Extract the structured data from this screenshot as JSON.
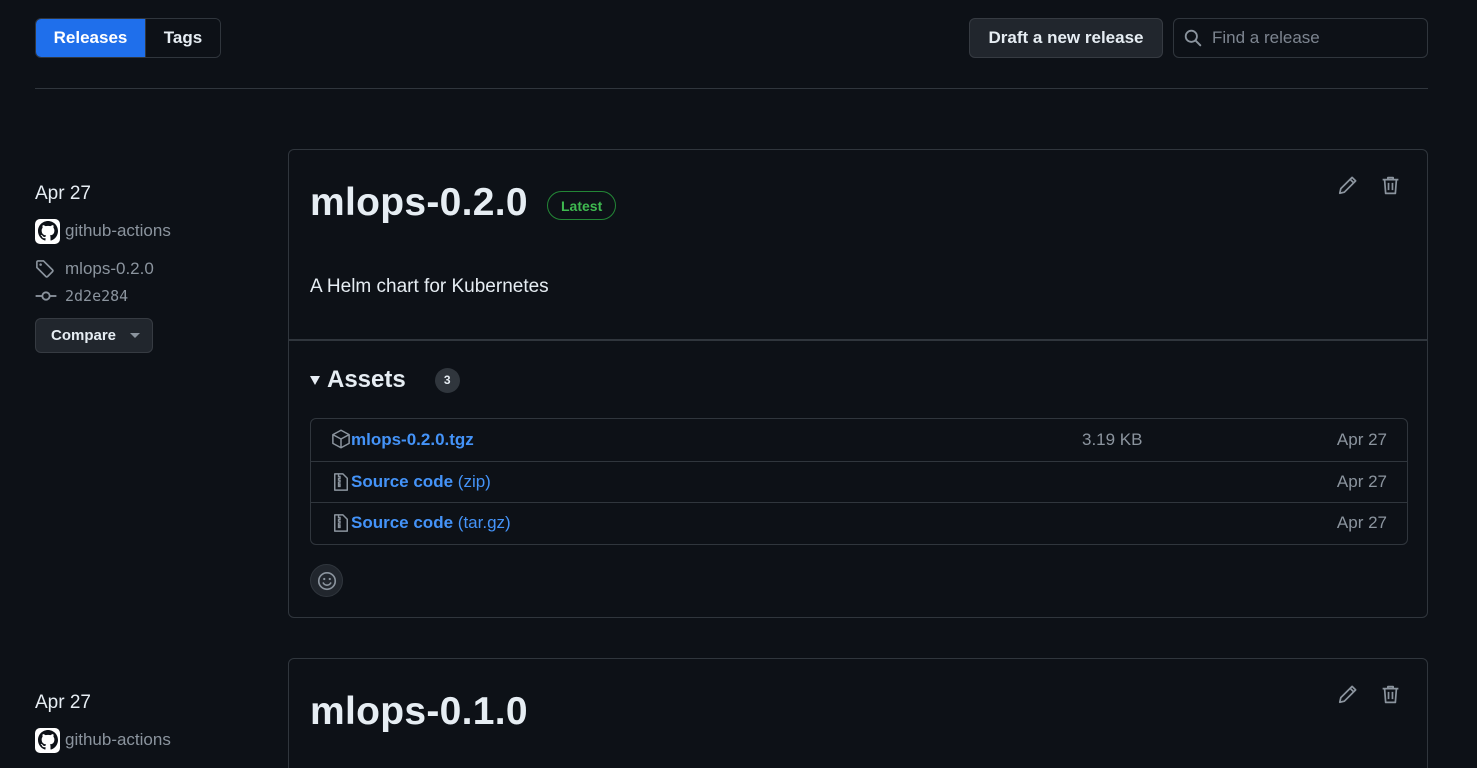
{
  "tabs": [
    {
      "label": "Releases",
      "active": true
    },
    {
      "label": "Tags",
      "active": false
    }
  ],
  "toolbar": {
    "draft_label": "Draft a new release",
    "search_placeholder": "Find a release"
  },
  "colors": {
    "accent": "#1f6feb",
    "link": "#4493f8",
    "latest_green": "#3fb950",
    "background": "#0d1117"
  },
  "releases": [
    {
      "date": "Apr 27",
      "author": "github-actions",
      "tag": "mlops-0.2.0",
      "commit": "2d2e284",
      "compare_label": "Compare",
      "title": "mlops-0.2.0",
      "badge": "Latest",
      "description": "A Helm chart for Kubernetes",
      "assets_label": "Assets",
      "assets_count": "3",
      "assets": [
        {
          "icon": "package-icon",
          "name": "mlops-0.2.0.tgz",
          "suffix": "",
          "size": "3.19 KB",
          "date": "Apr 27"
        },
        {
          "icon": "file-zip-icon",
          "name": "Source code",
          "suffix": "(zip)",
          "size": "",
          "date": "Apr 27"
        },
        {
          "icon": "file-zip-icon",
          "name": "Source code",
          "suffix": "(tar.gz)",
          "size": "",
          "date": "Apr 27"
        }
      ]
    },
    {
      "date": "Apr 27",
      "author": "github-actions",
      "title": "mlops-0.1.0"
    }
  ]
}
